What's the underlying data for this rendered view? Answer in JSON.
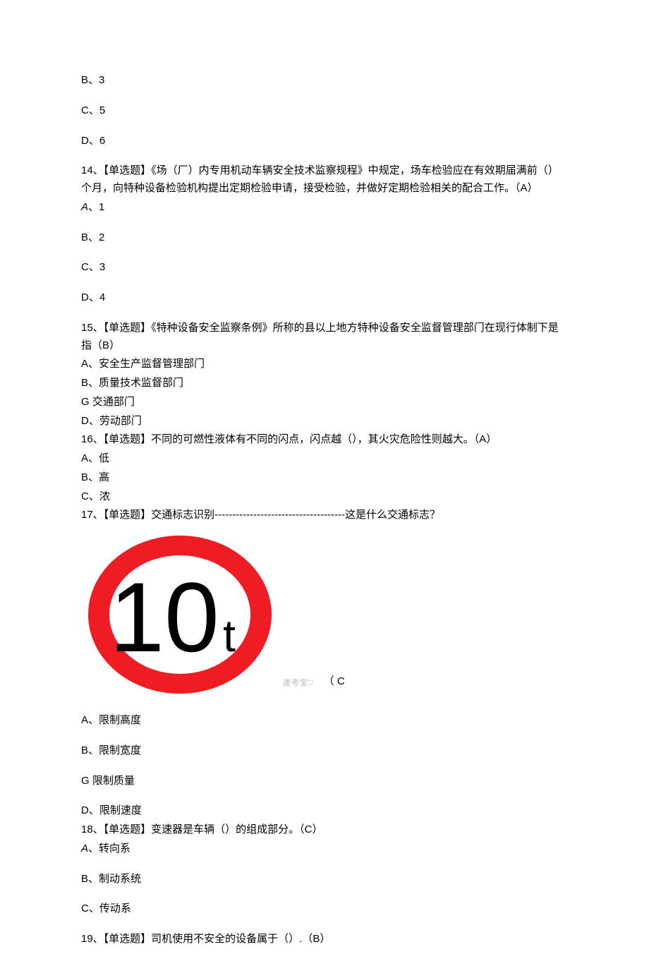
{
  "q13": {
    "opt_b": "B、3",
    "opt_c": "C、5",
    "opt_d": "D、6"
  },
  "q14": {
    "stem": "14、【单选题】《场（厂）内专用机动车辆安全技术监察规程》中规定，场车检验应在有效期届满前（）个月，向特种设备检验机构提出定期检验申请，接受检验，并做好定期检验相关的配合工作。（A）",
    "opt_a_prefix": "A",
    "opt_a_suffix": "、1",
    "opt_b": "B、2",
    "opt_c": "C、3",
    "opt_d": "D、4"
  },
  "q15": {
    "stem": "15、【单选题】《特种设备安全监察条例》所称的县以上地方特种设备安全监督管理部门在现行体制下是指（B）",
    "opt_a": "A、安全生产监督管理部门",
    "opt_b": "B、质量技术监督部门",
    "opt_c": "G 交通部门",
    "opt_d": "D、劳动部门"
  },
  "q16": {
    "stem": "16、【单选题】不同的可燃性液体有不同的闪点，闪点越（），其火灾危险性则越大。（A）",
    "opt_a": "A、低",
    "opt_b": "B、高",
    "opt_c": "C、浓"
  },
  "q17": {
    "stem": "17、【单选题】交通标志识别-------------------------------------这是什么交通标志？",
    "sign_text": "10",
    "sign_unit": "t",
    "watermark": "速考宝□",
    "answer_tag": "（ C",
    "opt_a": "A、限制高度",
    "opt_b": "B、限制宽度",
    "opt_c": "G 限制质量",
    "opt_d": "D、限制速度"
  },
  "q18": {
    "stem": "18、【单选题】变速器是车辆（）的组成部分。（C）",
    "opt_a_prefix": "A",
    "opt_a_suffix": "、转向系",
    "opt_b": "B、制动系统",
    "opt_c": "C、传动系"
  },
  "q19": {
    "stem": "19、【单选题】司机使用不安全的设备属于（）.（B）"
  }
}
